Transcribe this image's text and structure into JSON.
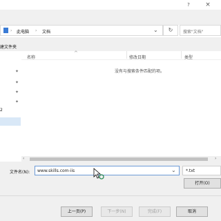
{
  "titlebar": {
    "help": "?",
    "close": "×"
  },
  "address": {
    "crumbs": [
      "此电脑",
      "文档"
    ],
    "separator": "›",
    "dropdown": "⌄",
    "refresh": "↻",
    "search_placeholder": "搜索\"文档\""
  },
  "toolbar": {
    "new_folder": "建文件夹"
  },
  "nav": {
    "pins": [
      "✦",
      "✦",
      "✦",
      "✦"
    ],
    "label": "2"
  },
  "columns": [
    {
      "label": "名称"
    },
    {
      "label": "修改日期"
    },
    {
      "label": "类型"
    }
  ],
  "empty_message": "没有与搜索条件匹配的项。",
  "filename": {
    "label": "文件名(N):",
    "value": "www.skills.com-iis"
  },
  "filetype": {
    "value": "*.txt"
  },
  "buttons": {
    "open": "打开(O)",
    "prev": "上一页(P)",
    "next": "下一步(N)",
    "finish": "完成(F)",
    "cancel": "取消"
  }
}
